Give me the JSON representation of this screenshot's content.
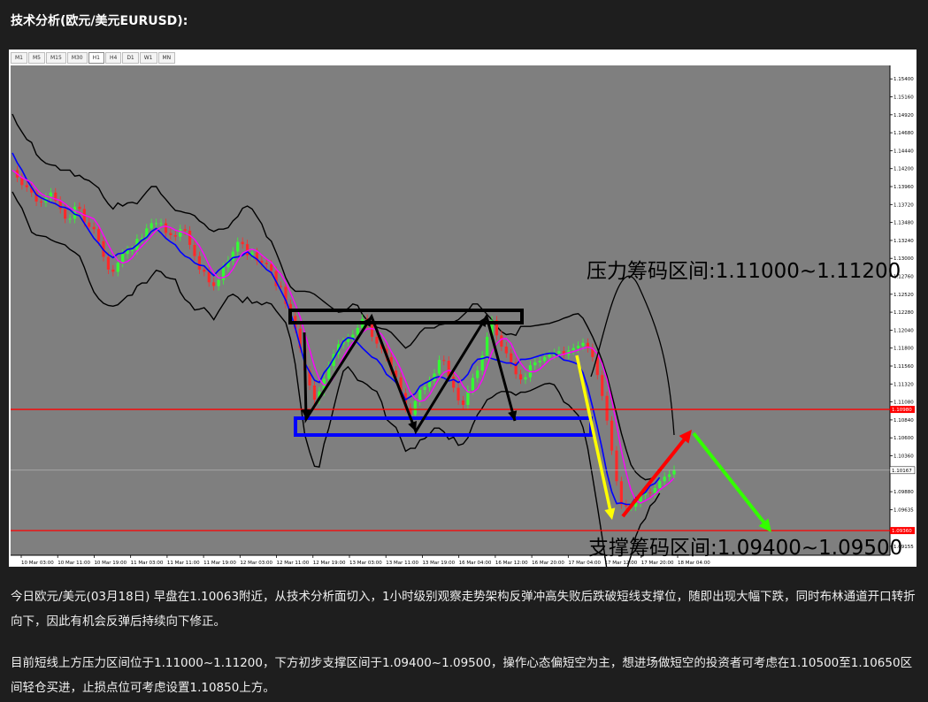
{
  "heading": "技术分析(欧元/美元EURUSD):",
  "timeframes": [
    "M1",
    "M5",
    "M15",
    "M30",
    "H1",
    "H4",
    "D1",
    "W1",
    "MN"
  ],
  "active_timeframe": "H1",
  "paragraphs": [
    "今日欧元/美元(03月18日) 早盘在1.10063附近，从技术分析面切入，1小时级别观察走势架构反弹冲高失败后跌破短线支撑位，随即出现大幅下跌，同时布林通道开口转折向下，因此有机会反弹后持续向下修正。",
    "目前短线上方压力区间位于1.11000~1.11200，下方初步支撑区间于1.09400~1.09500，操作心态偏短空为主，想进场做短空的投资者可考虑在1.10500至1.10650区间轻仓买进，止损点位可考虑设置1.10850上方。"
  ],
  "chart_data": {
    "type": "line",
    "symbol": "EURUSD",
    "timeframe": "H1",
    "ylim": [
      1.0903,
      1.1558
    ],
    "y_ticks": [
      1.154,
      1.1516,
      1.1492,
      1.1468,
      1.1444,
      1.142,
      1.1396,
      1.1372,
      1.1348,
      1.1324,
      1.13,
      1.1276,
      1.1252,
      1.1228,
      1.1204,
      1.118,
      1.1156,
      1.1132,
      1.1108,
      1.1084,
      1.106,
      1.1036,
      1.0988,
      1.0964,
      1.0915
    ],
    "y_tick_labels": [
      "1.15400",
      "1.15160",
      "1.14920",
      "1.14680",
      "1.14440",
      "1.14200",
      "1.13960",
      "1.13720",
      "1.13480",
      "1.13240",
      "1.13000",
      "1.12760",
      "1.12520",
      "1.12280",
      "1.12040",
      "1.11800",
      "1.11560",
      "1.11320",
      "1.11080",
      "1.10840",
      "1.10600",
      "1.10360",
      "1.09880",
      "1.09635",
      "1.09155"
    ],
    "x_labels": [
      "10 Mar 03:00",
      "10 Mar 11:00",
      "10 Mar 19:00",
      "11 Mar 03:00",
      "11 Mar 11:00",
      "11 Mar 19:00",
      "12 Mar 03:00",
      "12 Mar 11:00",
      "12 Mar 19:00",
      "13 Mar 03:00",
      "13 Mar 11:00",
      "13 Mar 19:00",
      "16 Mar 04:00",
      "16 Mar 12:00",
      "16 Mar 20:00",
      "17 Mar 04:00",
      "17 Mar 12:00",
      "17 Mar 20:00",
      "18 Mar 04:00"
    ],
    "current_price_label": "1.10167",
    "current_price": 1.10167,
    "close_series": [
      1.1418,
      1.1408,
      1.1398,
      1.1395,
      1.1388,
      1.1376,
      1.1375,
      1.1381,
      1.1388,
      1.1377,
      1.1366,
      1.1353,
      1.1353,
      1.1369,
      1.1366,
      1.1348,
      1.1342,
      1.1339,
      1.1323,
      1.1302,
      1.1285,
      1.1282,
      1.1294,
      1.1306,
      1.1311,
      1.1311,
      1.1326,
      1.1327,
      1.134,
      1.1347,
      1.1347,
      1.1347,
      1.1334,
      1.1331,
      1.1329,
      1.1339,
      1.1337,
      1.1318,
      1.1303,
      1.1285,
      1.1282,
      1.1268,
      1.1263,
      1.1271,
      1.1288,
      1.1297,
      1.1309,
      1.1322,
      1.1319,
      1.1304,
      1.1308,
      1.1297,
      1.1294,
      1.1292,
      1.1283,
      1.1263,
      1.1262,
      1.1239,
      1.1223,
      1.1206,
      1.118,
      1.115,
      1.113,
      1.1111,
      1.1122,
      1.1139,
      1.1156,
      1.1172,
      1.1185,
      1.1188,
      1.1193,
      1.1198,
      1.1207,
      1.1219,
      1.1212,
      1.1195,
      1.1186,
      1.1179,
      1.1168,
      1.115,
      1.1141,
      1.112,
      1.11,
      1.1091,
      1.1109,
      1.1124,
      1.1128,
      1.1136,
      1.1146,
      1.1164,
      1.1163,
      1.1142,
      1.1127,
      1.111,
      1.1104,
      1.1124,
      1.114,
      1.115,
      1.117,
      1.1195,
      1.1217,
      1.1197,
      1.1182,
      1.1173,
      1.1161,
      1.1145,
      1.1138,
      1.1141,
      1.1157,
      1.1161,
      1.1163,
      1.1168,
      1.1171,
      1.1173,
      1.1176,
      1.1171,
      1.1177,
      1.118,
      1.1183,
      1.1187,
      1.118,
      1.1168,
      1.1144,
      1.1116,
      1.1083,
      1.1043,
      1.1002,
      1.0971,
      1.0968,
      1.0968,
      1.0973,
      1.0984,
      1.0987,
      1.0986,
      1.0993,
      1.1002,
      1.1008,
      1.1011,
      1.1017
    ],
    "middle_band": [
      1.1441,
      1.1428,
      1.1418,
      1.1405,
      1.1395,
      1.1385,
      1.1381,
      1.1378,
      1.1375,
      1.1373,
      1.1369,
      1.1368,
      1.1365,
      1.1359,
      1.1357,
      1.1347,
      1.1337,
      1.1327,
      1.132,
      1.1311,
      1.1305,
      1.1301,
      1.1306,
      1.1307,
      1.1312,
      1.1313,
      1.1318,
      1.1324,
      1.1328,
      1.1336,
      1.134,
      1.1334,
      1.1327,
      1.1322,
      1.1318,
      1.1309,
      1.1303,
      1.13,
      1.1294,
      1.1291,
      1.129,
      1.1283,
      1.1277,
      1.1284,
      1.1289,
      1.1295,
      1.1301,
      1.1302,
      1.1304,
      1.1309,
      1.1303,
      1.1299,
      1.1292,
      1.1285,
      1.1281,
      1.1269,
      1.1257,
      1.1244,
      1.1227,
      1.1207,
      1.1183,
      1.116,
      1.1148,
      1.1137,
      1.1134,
      1.1147,
      1.1155,
      1.1166,
      1.1177,
      1.1189,
      1.1194,
      1.1193,
      1.1187,
      1.118,
      1.1174,
      1.1168,
      1.1165,
      1.1157,
      1.1145,
      1.114,
      1.1134,
      1.1123,
      1.1111,
      1.1115,
      1.1119,
      1.1129,
      1.1133,
      1.1136,
      1.114,
      1.1142,
      1.114,
      1.1136,
      1.1138,
      1.1134,
      1.1138,
      1.1145,
      1.1158,
      1.1165,
      1.1166,
      1.1168,
      1.1166,
      1.1164,
      1.1162,
      1.116,
      1.116,
      1.1157,
      1.1165,
      1.1165,
      1.1166,
      1.1168,
      1.117,
      1.1172,
      1.1173,
      1.1173,
      1.1169,
      1.1164,
      1.1163,
      1.1161,
      1.1158,
      1.1147,
      1.1127,
      1.1101,
      1.1074,
      1.1045,
      1.1013,
      1.0988,
      1.0972,
      1.0973,
      1.0971,
      1.0971,
      1.098,
      1.0983,
      1.0987,
      1.0996,
      1.0999,
      1.1007
    ],
    "upper_band": [
      1.1493,
      1.1479,
      1.1469,
      1.1459,
      1.1455,
      1.1439,
      1.1432,
      1.1427,
      1.1425,
      1.1424,
      1.1418,
      1.1418,
      1.1418,
      1.141,
      1.1411,
      1.1406,
      1.1404,
      1.1399,
      1.1394,
      1.1382,
      1.1373,
      1.1366,
      1.1374,
      1.137,
      1.1374,
      1.1375,
      1.1373,
      1.1381,
      1.1389,
      1.1396,
      1.1396,
      1.1386,
      1.1379,
      1.1371,
      1.1364,
      1.1363,
      1.1361,
      1.136,
      1.1357,
      1.135,
      1.1346,
      1.1339,
      1.1336,
      1.1339,
      1.1339,
      1.1341,
      1.135,
      1.1356,
      1.1367,
      1.137,
      1.1366,
      1.1356,
      1.1346,
      1.1329,
      1.1323,
      1.1308,
      1.1292,
      1.1274,
      1.1262,
      1.1256,
      1.1256,
      1.1256,
      1.1255,
      1.1252,
      1.1247,
      1.1242,
      1.1237,
      1.1232,
      1.1228,
      1.1229,
      1.1233,
      1.1239,
      1.1237,
      1.1225,
      1.1217,
      1.1211,
      1.1208,
      1.1206,
      1.1205,
      1.1201,
      1.1194,
      1.1187,
      1.118,
      1.1184,
      1.1192,
      1.1201,
      1.1207,
      1.1207,
      1.1207,
      1.1211,
      1.1212,
      1.1214,
      1.1215,
      1.1218,
      1.1224,
      1.123,
      1.1239,
      1.1239,
      1.1232,
      1.1225,
      1.1218,
      1.1209,
      1.1202,
      1.1198,
      1.1199,
      1.1197,
      1.1209,
      1.1209,
      1.1209,
      1.121,
      1.1211,
      1.1212,
      1.1213,
      1.1215,
      1.1217,
      1.122,
      1.1222,
      1.1225,
      1.1226,
      1.122,
      1.1208,
      1.1195,
      1.118,
      1.1163,
      1.1143,
      1.1118,
      1.1092,
      1.1066,
      1.1044,
      1.1024,
      1.1014,
      1.1008,
      1.1004,
      1.1005,
      1.1008,
      1.1014
    ],
    "lower_band": [
      1.1389,
      1.1377,
      1.1367,
      1.1351,
      1.1335,
      1.1331,
      1.133,
      1.1329,
      1.1325,
      1.1322,
      1.132,
      1.1318,
      1.1312,
      1.1308,
      1.1303,
      1.1288,
      1.127,
      1.1255,
      1.1246,
      1.124,
      1.1237,
      1.1236,
      1.1238,
      1.1244,
      1.125,
      1.1251,
      1.1263,
      1.1267,
      1.1267,
      1.1276,
      1.1284,
      1.1282,
      1.1275,
      1.1273,
      1.1272,
      1.1255,
      1.1245,
      1.124,
      1.1231,
      1.1232,
      1.1234,
      1.1227,
      1.1218,
      1.1229,
      1.1239,
      1.1249,
      1.1252,
      1.1248,
      1.1241,
      1.1248,
      1.124,
      1.1242,
      1.1238,
      1.1241,
      1.1239,
      1.123,
      1.1222,
      1.1214,
      1.1192,
      1.1158,
      1.111,
      1.1064,
      1.1041,
      1.1022,
      1.1021,
      1.1052,
      1.1073,
      1.11,
      1.1126,
      1.1149,
      1.1155,
      1.1147,
      1.1137,
      1.1135,
      1.1131,
      1.1125,
      1.1122,
      1.1108,
      1.1085,
      1.1079,
      1.1074,
      1.1059,
      1.1042,
      1.1046,
      1.1046,
      1.1057,
      1.1059,
      1.1065,
      1.1073,
      1.1073,
      1.1068,
      1.1058,
      1.1061,
      1.105,
      1.1052,
      1.106,
      1.1077,
      1.1091,
      1.11,
      1.1111,
      1.1114,
      1.1119,
      1.1122,
      1.1122,
      1.1121,
      1.1117,
      1.1121,
      1.1121,
      1.1123,
      1.1126,
      1.1129,
      1.1132,
      1.1133,
      1.1131,
      1.1121,
      1.1108,
      1.1104,
      1.1097,
      1.109,
      1.1074,
      1.1046,
      1.1007,
      1.0968,
      1.0927,
      1.0883,
      1.0858,
      1.0852,
      1.0862,
      1.0881,
      1.0902,
      1.0928,
      1.0944,
      1.0952,
      1.0969,
      1.0975,
      1.0986
    ]
  },
  "annotations": {
    "resistance_label": "压力筹码区间:1.11000~1.11200",
    "support_label": "支撑筹码区间:1.09400~1.09500",
    "red_line_upper": 1.1098,
    "red_line_lower": 1.0936,
    "red_line_upper_tag": "1.10980",
    "red_line_lower_tag": "1.09360"
  },
  "colors": {
    "plot_bg": "#7f7f7f",
    "bull_candle": "#33ff33",
    "bear_candle": "#ff2a2a",
    "middle_band": "#0000ff",
    "bollinger": "#000000",
    "ma_fast": "#ff00ff",
    "level_line": "#ff0000",
    "resistance_box": "#000000",
    "support_box": "#0000ff",
    "yellow_arrow": "#ffff00",
    "red_arrow": "#ff0000",
    "green_arrow": "#33ff00"
  }
}
